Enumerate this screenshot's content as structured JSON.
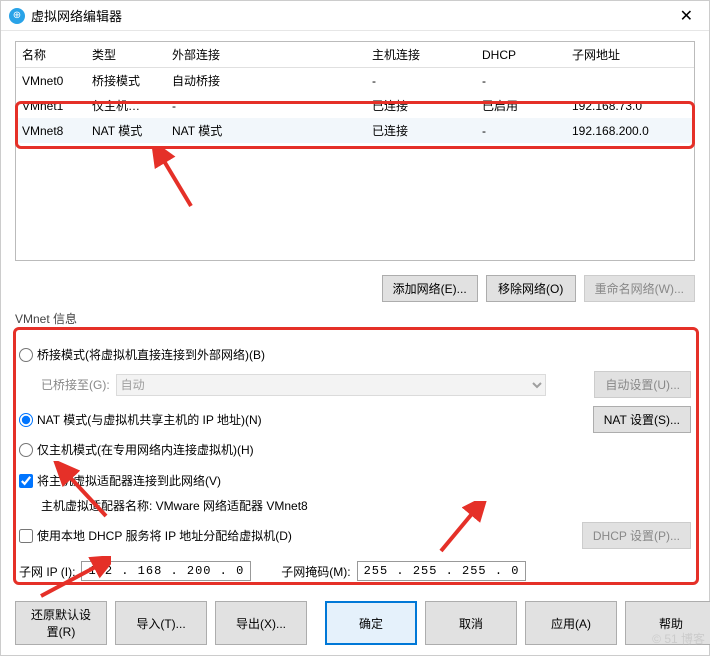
{
  "window": {
    "title": "虚拟网络编辑器"
  },
  "table": {
    "headers": [
      "名称",
      "类型",
      "外部连接",
      "主机连接",
      "DHCP",
      "子网地址"
    ],
    "rows": [
      {
        "name": "VMnet0",
        "type": "桥接模式",
        "ext": "自动桥接",
        "host": "-",
        "dhcp": "-",
        "subnet": ""
      },
      {
        "name": "VMnet1",
        "type": "仅主机…",
        "ext": "-",
        "host": "已连接",
        "dhcp": "已启用",
        "subnet": "192.168.73.0"
      },
      {
        "name": "VMnet8",
        "type": "NAT 模式",
        "ext": "NAT 模式",
        "host": "已连接",
        "dhcp": "-",
        "subnet": "192.168.200.0"
      }
    ]
  },
  "mid": {
    "add": "添加网络(E)...",
    "remove": "移除网络(O)",
    "rename": "重命名网络(W)..."
  },
  "group": {
    "title": "VMnet 信息"
  },
  "modes": {
    "bridge": "桥接模式(将虚拟机直接连接到外部网络)(B)",
    "bridge_to": "已桥接至(G):",
    "bridge_auto": "自动",
    "auto_set": "自动设置(U)...",
    "nat": "NAT 模式(与虚拟机共享主机的 IP 地址)(N)",
    "nat_set": "NAT 设置(S)...",
    "hostonly": "仅主机模式(在专用网络内连接虚拟机)(H)",
    "connect_host": "将主机虚拟适配器连接到此网络(V)",
    "adapter_label": "主机虚拟适配器名称: VMware 网络适配器 VMnet8",
    "use_dhcp": "使用本地 DHCP 服务将 IP 地址分配给虚拟机(D)",
    "dhcp_set": "DHCP 设置(P)...",
    "subnet_ip_label": "子网 IP (I):",
    "subnet_ip": "192 . 168 . 200 .  0",
    "subnet_mask_label": "子网掩码(M):",
    "subnet_mask": "255 . 255 . 255 .  0"
  },
  "bottom": {
    "restore": "还原默认设置(R)",
    "import": "导入(T)...",
    "export": "导出(X)...",
    "ok": "确定",
    "cancel": "取消",
    "apply": "应用(A)",
    "help": "帮助"
  },
  "watermark": "© 51 博客"
}
